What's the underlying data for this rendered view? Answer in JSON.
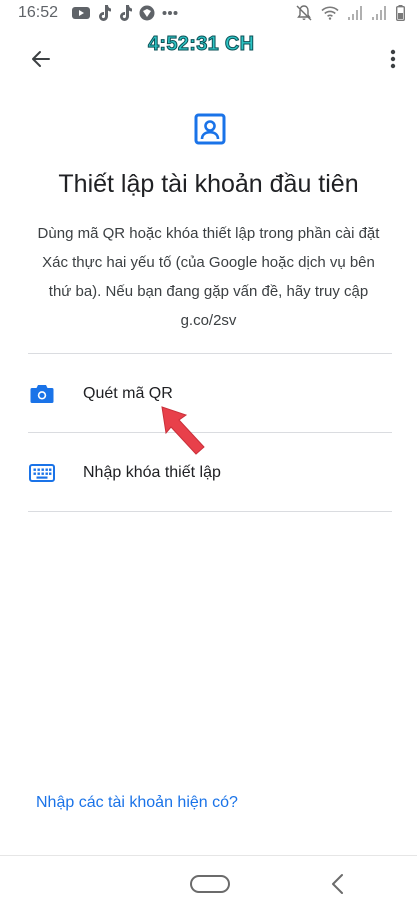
{
  "status_bar": {
    "time": "16:52",
    "left_icons": [
      "youtube-icon",
      "tiktok-icon",
      "tiktok-icon",
      "vpn-icon",
      "more-dots-icon"
    ],
    "right_icons": [
      "mute-icon",
      "wifi-icon",
      "signal-icon",
      "signal-icon",
      "battery-icon"
    ]
  },
  "overlay_clock": "4:52:31 CH",
  "toolbar": {
    "back_icon": "arrow-back-icon",
    "menu_icon": "more-vert-icon"
  },
  "header": {
    "icon": "account-box-icon",
    "title": "Thiết lập tài khoản đầu tiên",
    "description": "Dùng mã QR hoặc khóa thiết lập trong phần cài đặt Xác thực hai yếu tố (của Google hoặc dịch vụ bên thứ ba). Nếu bạn đang gặp vấn đề, hãy truy cập g.co/2sv"
  },
  "options": [
    {
      "icon": "camera-icon",
      "label": "Quét mã QR"
    },
    {
      "icon": "keyboard-icon",
      "label": "Nhập khóa thiết lập"
    }
  ],
  "import_link": "Nhập các tài khoản hiện có?",
  "nav_bar": {
    "home": "home-pill",
    "back": "nav-back-icon"
  },
  "colors": {
    "accent": "#1a73e8",
    "overlay_clock": "#2ec4c4",
    "annotation_arrow": "#e8404a"
  }
}
